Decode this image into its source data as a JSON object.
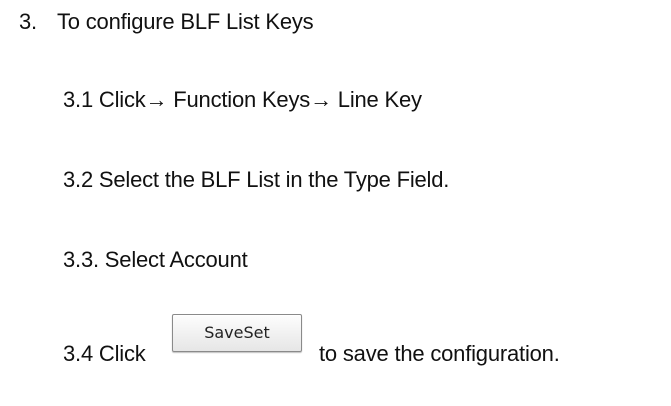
{
  "heading": {
    "number": "3.",
    "text": "To configure BLF List Keys"
  },
  "steps": [
    "3.1 Click→ Function Keys→ Line Key",
    "3.2 Select the BLF List in the Type Field.",
    "3.3. Select Account",
    "3.4 Click"
  ],
  "save_button_label": "SaveSet",
  "after_button_text": "to save the configuration."
}
